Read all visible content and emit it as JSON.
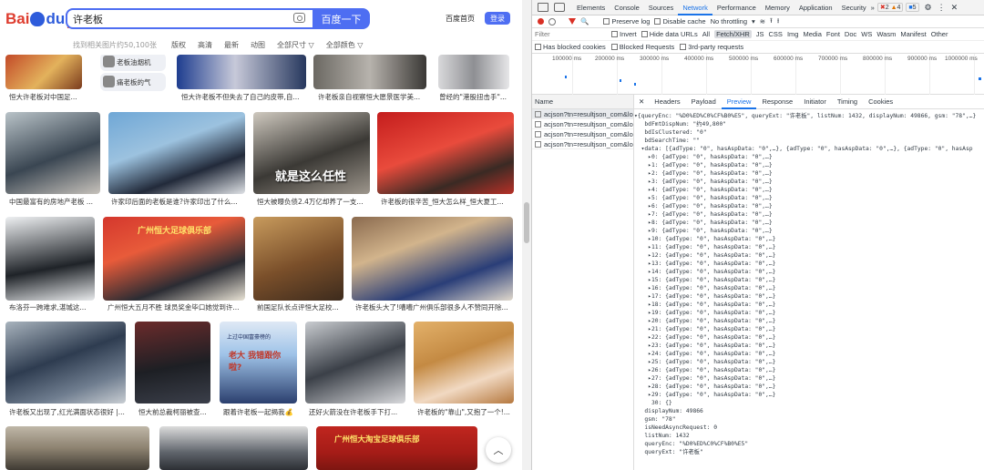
{
  "baidu": {
    "logo_text": "Bai",
    "logo_du": "du",
    "logo_cn": "百度",
    "search_value": "许老板",
    "search_button": "百度一下",
    "home_link": "百度首页",
    "login_button": "登录",
    "result_count": "找到相关图片约50,100张",
    "filters": [
      "版权",
      "高清",
      "最新",
      "动图",
      "全部尺寸 ▽",
      "全部颜色 ▽"
    ],
    "related": [
      "老板油烟机",
      "痛老板的气"
    ],
    "captions": [
      "恒大许老板对中国足...",
      "恒大许老板不但失去了自己的皮带,自...",
      "许老板亲自视察恒大愿景医学美...",
      "曾经的\"港股扭击手\"...",
      "中国最富有的房地产老板 ...",
      "许家印后面的老板是谁?许家印出了什么...",
      "恒大被曝负债2.4万亿却养了一支...",
      "许老板的很辛苦_恒大怎么样_恒大夏工...",
      "布洛芬一跨难求,湛城这...",
      "广州恒大五月不胜 球员奖金毕口她觉到许...",
      "前国足队长点评恒大足校...",
      "许老板头大了!嘈嘈广州俱乐部很多人不赞同开除...",
      "许老板又出现了,红光满面状态很好 |...",
      "恒大前总裁柯丽被查...",
      "跟着许老板一起揭我💰",
      "还好火箭没在许老板手下打...",
      "许老板的\"靠山\",又抱了一个!..."
    ],
    "overlay_texts": [
      "就是这么任性",
      "广州恒大足球俱乐部",
      "上过中国富豪榜的",
      "老大 我错跟你啦?",
      "广州恒大淘宝足球俱乐部"
    ]
  },
  "devtools": {
    "tabs": [
      "Elements",
      "Console",
      "Sources",
      "Network",
      "Performance",
      "Memory",
      "Application",
      "Security"
    ],
    "selected_tab": "Network",
    "badge_errors": "2",
    "badge_warnings": "4",
    "badge_info": "5",
    "toolbar": {
      "preserve_log": "Preserve log",
      "disable_cache": "Disable cache",
      "throttling": "No throttling"
    },
    "filter_label": "Filter",
    "filter_types": [
      "Invert",
      "Hide data URLs",
      "All",
      "Fetch/XHR",
      "JS",
      "CSS",
      "Img",
      "Media",
      "Font",
      "Doc",
      "WS",
      "Wasm",
      "Manifest",
      "Other"
    ],
    "filter_selected": "Fetch/XHR",
    "checks": [
      "Has blocked cookies",
      "Blocked Requests",
      "3rd-party requests"
    ],
    "timeline_ticks": [
      "100000 ms",
      "200000 ms",
      "300000 ms",
      "400000 ms",
      "500000 ms",
      "600000 ms",
      "700000 ms",
      "800000 ms",
      "900000 ms",
      "1000000 ms"
    ],
    "name_header": "Name",
    "requests": [
      "acjson?tn=resultjson_com&lo...",
      "acjson?tn=resultjson_com&lo...",
      "acjson?tn=resultjson_com&lo...",
      "acjson?tn=resultjson_com&lo..."
    ],
    "detail_tabs": [
      "Headers",
      "Payload",
      "Preview",
      "Response",
      "Initiator",
      "Timing",
      "Cookies"
    ],
    "detail_selected": "Preview",
    "preview_lines": [
      "▾{queryEnc: \"%D0%ED%C0%CF%B0%E5\", queryExt: \"许老板\", listNum: 1432, displayNum: 49866, gsm: \"78\",…}",
      "   bdFmtDispNum: \"约49,800\"",
      "   bdIsClustered: \"0\"",
      "   bdSearchTime: \"\"",
      "  ▾data: [{adType: \"0\", hasAspData: \"0\",…}, {adType: \"0\", hasAspData: \"0\",…}, {adType: \"0\", hasAsp",
      "    ▸0: {adType: \"0\", hasAspData: \"0\",…}",
      "    ▸1: {adType: \"0\", hasAspData: \"0\",…}",
      "    ▸2: {adType: \"0\", hasAspData: \"0\",…}",
      "    ▸3: {adType: \"0\", hasAspData: \"0\",…}",
      "    ▸4: {adType: \"0\", hasAspData: \"0\",…}",
      "    ▸5: {adType: \"0\", hasAspData: \"0\",…}",
      "    ▸6: {adType: \"0\", hasAspData: \"0\",…}",
      "    ▸7: {adType: \"0\", hasAspData: \"0\",…}",
      "    ▸8: {adType: \"0\", hasAspData: \"0\",…}",
      "    ▸9: {adType: \"0\", hasAspData: \"0\",…}",
      "    ▸10: {adType: \"0\", hasAspData: \"0\",…}",
      "    ▸11: {adType: \"0\", hasAspData: \"0\",…}",
      "    ▸12: {adType: \"0\", hasAspData: \"0\",…}",
      "    ▸13: {adType: \"0\", hasAspData: \"0\",…}",
      "    ▸14: {adType: \"0\", hasAspData: \"0\",…}",
      "    ▸15: {adType: \"0\", hasAspData: \"0\",…}",
      "    ▸16: {adType: \"0\", hasAspData: \"0\",…}",
      "    ▸17: {adType: \"0\", hasAspData: \"0\",…}",
      "    ▸18: {adType: \"0\", hasAspData: \"0\",…}",
      "    ▸19: {adType: \"0\", hasAspData: \"0\",…}",
      "    ▸20: {adType: \"0\", hasAspData: \"0\",…}",
      "    ▸21: {adType: \"0\", hasAspData: \"0\",…}",
      "    ▸22: {adType: \"0\", hasAspData: \"0\",…}",
      "    ▸23: {adType: \"0\", hasAspData: \"0\",…}",
      "    ▸24: {adType: \"0\", hasAspData: \"0\",…}",
      "    ▸25: {adType: \"0\", hasAspData: \"0\",…}",
      "    ▸26: {adType: \"0\", hasAspData: \"0\",…}",
      "    ▸27: {adType: \"0\", hasAspData: \"0\",…}",
      "    ▸28: {adType: \"0\", hasAspData: \"0\",…}",
      "    ▸29: {adType: \"0\", hasAspData: \"0\",…}",
      "     30: {}",
      "   displayNum: 49866",
      "   gsm: \"78\"",
      "   isNeedAsyncRequest: 0",
      "   listNum: 1432",
      "   queryEnc: \"%D0%ED%C0%CF%B0%E5\"",
      "   queryExt: \"许老板\""
    ]
  }
}
